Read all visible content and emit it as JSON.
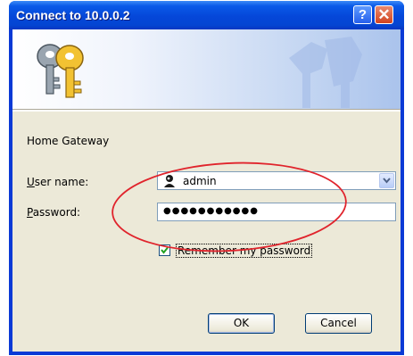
{
  "window": {
    "title": "Connect to 10.0.0.2",
    "help_label": "?",
    "close_label": "✕"
  },
  "dialog": {
    "site_name": "Home Gateway",
    "username_label_key": "U",
    "username_label_rest": "ser name:",
    "username_value": "admin",
    "password_label_key": "P",
    "password_label_rest": "assword:",
    "password_value": "●●●●●●●●●●●",
    "remember_label": "Remember my password",
    "remember_checked": true,
    "ok_label": "OK",
    "cancel_label": "Cancel"
  },
  "icons": [
    "keys-icon",
    "user-icon",
    "chevron-down-icon",
    "checkmark-icon",
    "help-icon",
    "close-icon"
  ],
  "colors": {
    "titlebar": "#0547d9",
    "annotation": "#e0242c",
    "dialog_bg": "#ece9d8"
  }
}
